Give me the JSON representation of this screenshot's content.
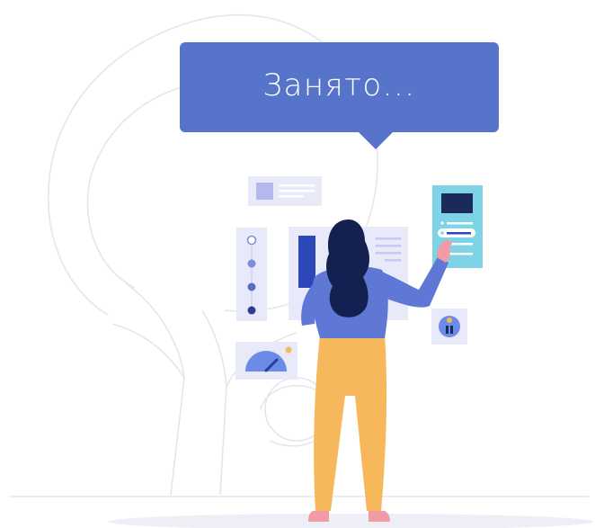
{
  "status": {
    "message": "Занято..."
  },
  "colors": {
    "bubble": "#5774cb",
    "outline": "#e6e6ea",
    "panel": "#e6e8f8",
    "accent_dark": "#1a2a5a",
    "accent_blue": "#2b47b8",
    "shirt": "#5f78d6",
    "pants": "#f6b85a",
    "skin": "#f29aa6",
    "tablet": "#7fd3e6",
    "ground": "#eeeef6"
  },
  "illustration": {
    "subject": "person-touching-interface-panels",
    "background": "tree-outline"
  }
}
